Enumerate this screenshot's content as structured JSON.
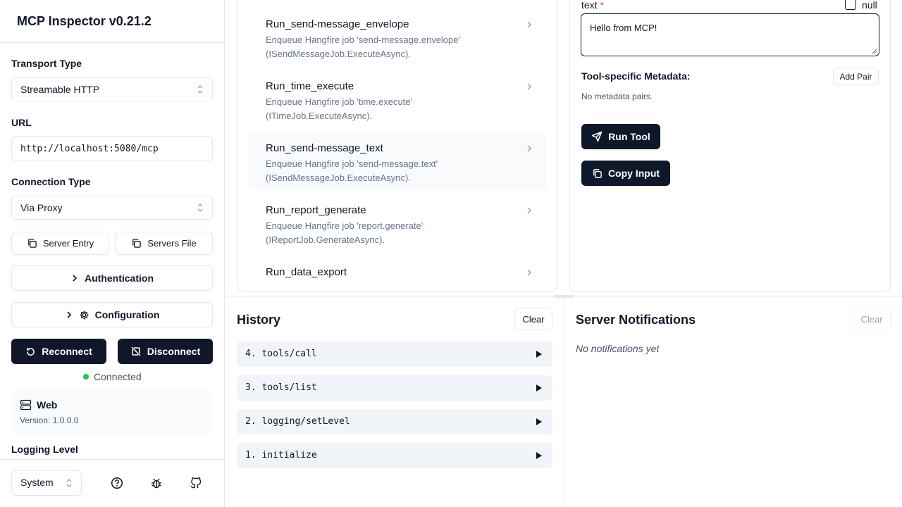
{
  "app": {
    "title": "MCP Inspector v0.21.2"
  },
  "sidebar": {
    "transport_label": "Transport Type",
    "transport_value": "Streamable HTTP",
    "url_label": "URL",
    "url_value": "http://localhost:5080/mcp",
    "connection_label": "Connection Type",
    "connection_value": "Via Proxy",
    "server_entry_label": "Server Entry",
    "servers_file_label": "Servers File",
    "authentication_label": "Authentication",
    "configuration_label": "Configuration",
    "reconnect_label": "Reconnect",
    "disconnect_label": "Disconnect",
    "status_text": "Connected",
    "status_color": "#22c55e",
    "server_name": "Web",
    "server_version": "Version: 1.0.0.0",
    "logging_label": "Logging Level",
    "theme_value": "System"
  },
  "tools": [
    {
      "name": "Run_send-message_envelope",
      "desc": "Enqueue Hangfire job 'send-message.envelope' (ISendMessageJob.ExecuteAsync)."
    },
    {
      "name": "Run_time_execute",
      "desc": "Enqueue Hangfire job 'time.execute' (ITimeJob.ExecuteAsync)."
    },
    {
      "name": "Run_send-message_text",
      "desc": "Enqueue Hangfire job 'send-message.text' (ISendMessageJob.ExecuteAsync)."
    },
    {
      "name": "Run_report_generate",
      "desc": "Enqueue Hangfire job 'report.generate' (IReportJob.GenerateAsync)."
    },
    {
      "name": "Run_data_export",
      "desc": ""
    }
  ],
  "detail": {
    "param_name": "text",
    "required_mark": "*",
    "null_label": "null",
    "text_value": "Hello from MCP!",
    "metadata_label": "Tool-specific Metadata:",
    "add_pair_label": "Add Pair",
    "no_metadata": "No metadata pairs.",
    "run_tool_label": "Run Tool",
    "copy_input_label": "Copy Input"
  },
  "history": {
    "title": "History",
    "clear_label": "Clear",
    "items": [
      "4. tools/call",
      "3. tools/list",
      "2. logging/setLevel",
      "1. initialize"
    ]
  },
  "notifications": {
    "title": "Server Notifications",
    "clear_label": "Clear",
    "empty_text": "No notifications yet"
  }
}
